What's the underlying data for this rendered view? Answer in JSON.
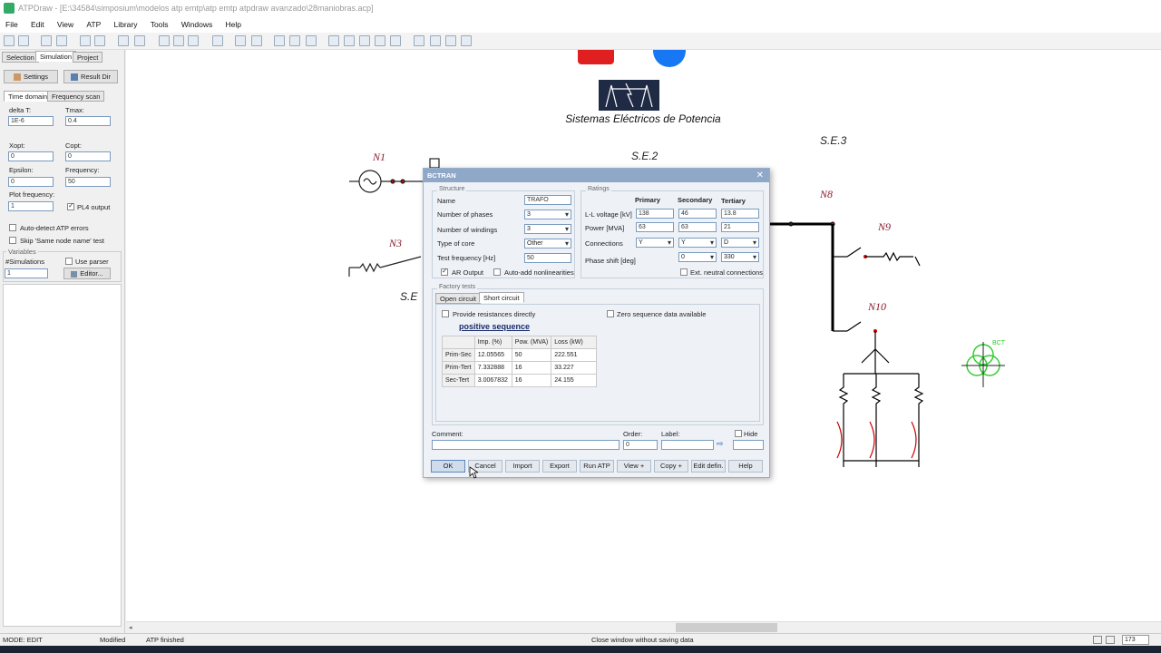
{
  "window": {
    "title": "ATPDraw - [E:\\34584\\simposium\\modelos atp emtp\\atp emtp atpdraw avanzado\\28maniobras.acp]"
  },
  "menu": [
    "File",
    "Edit",
    "View",
    "ATP",
    "Library",
    "Tools",
    "Windows",
    "Help"
  ],
  "left_panel": {
    "tabs": [
      "Selection",
      "Simulation",
      "Project"
    ],
    "settings_label": "Settings",
    "result_dir_label": "Result Dir",
    "subtabs": [
      "Time domain",
      "Frequency scan"
    ],
    "delta_t_label": "delta T:",
    "delta_t": "1E-6",
    "tmax_label": "Tmax:",
    "tmax": "0.4",
    "xopt_label": "Xopt:",
    "xopt": "0",
    "copt_label": "Copt:",
    "copt": "0",
    "epsilon_label": "Epsilon:",
    "epsilon": "0",
    "frequency_label": "Frequency:",
    "frequency": "50",
    "plot_freq_label": "Plot frequency:",
    "plot_freq": "1",
    "pl4_label": "PL4 output",
    "auto_detect_label": "Auto-detect ATP errors",
    "skip_label": "Skip 'Same node name' test",
    "variables_label": "Variables",
    "simulations_label": "#Simulations",
    "simulations": "1",
    "use_parser_label": "Use parser",
    "editor_label": "Editor..."
  },
  "canvas": {
    "banner_text": "Sistemas Eléctricos de Potencia",
    "labels": {
      "n1": "N1",
      "n3": "N3",
      "n8": "N8",
      "n9": "N9",
      "n10": "N10",
      "se2": "S.E.2",
      "se3": "S.E.3",
      "se_partial": "S.E",
      "bct": "BCT"
    }
  },
  "dialog": {
    "title": "BCTRAN",
    "structure_label": "Structure",
    "name_label": "Name",
    "name": "TRAFO",
    "phases_label": "Number of phases",
    "phases": "3",
    "windings_label": "Number of windings",
    "windings": "3",
    "core_label": "Type of core",
    "core": "Other",
    "test_freq_label": "Test frequency [Hz]",
    "test_freq": "50",
    "ar_output_label": "AR Output",
    "auto_add_label": "Auto-add nonlinearities",
    "ratings_label": "Ratings",
    "col_primary": "Primary",
    "col_secondary": "Secondary",
    "col_tertiary": "Tertiary",
    "ll_voltage_label": "L-L voltage [kV]",
    "ll_voltage": [
      "138",
      "46",
      "13.8"
    ],
    "power_label": "Power [MVA]",
    "power": [
      "63",
      "63",
      "21"
    ],
    "connections_label": "Connections",
    "connections": [
      "Y",
      "Y",
      "D"
    ],
    "phase_shift_label": "Phase shift [deg]",
    "phase_shift": [
      "0",
      "330"
    ],
    "ext_neutral_label": "Ext. neutral connections",
    "factory_tests_label": "Factory tests",
    "tabs": [
      "Open circuit",
      "Short circuit"
    ],
    "provide_res_label": "Provide resistances directly",
    "zero_seq_label": "Zero sequence data available",
    "pos_seq_label": "positive sequence",
    "table_headers": [
      "",
      "Imp. (%)",
      "Pow. (MVA)",
      "Loss (kW)"
    ],
    "table_rows": [
      [
        "Prim-Sec",
        "12.05565",
        "50",
        "222.551"
      ],
      [
        "Prim-Tert",
        "7.332888",
        "16",
        "33.227"
      ],
      [
        "Sec-Tert",
        "3.0067832",
        "16",
        "24.155"
      ]
    ],
    "comment_label": "Comment:",
    "order_label": "Order:",
    "order": "0",
    "label_label": "Label:",
    "hide_label": "Hide",
    "buttons": [
      "OK",
      "Cancel",
      "Import",
      "Export",
      "Run ATP",
      "View +",
      "Copy +",
      "Edit defin.",
      "Help"
    ]
  },
  "status": {
    "mode": "MODE: EDIT",
    "modified": "Modified",
    "atp": "ATP finished",
    "message": "Close window without saving data",
    "zoom": "173"
  }
}
